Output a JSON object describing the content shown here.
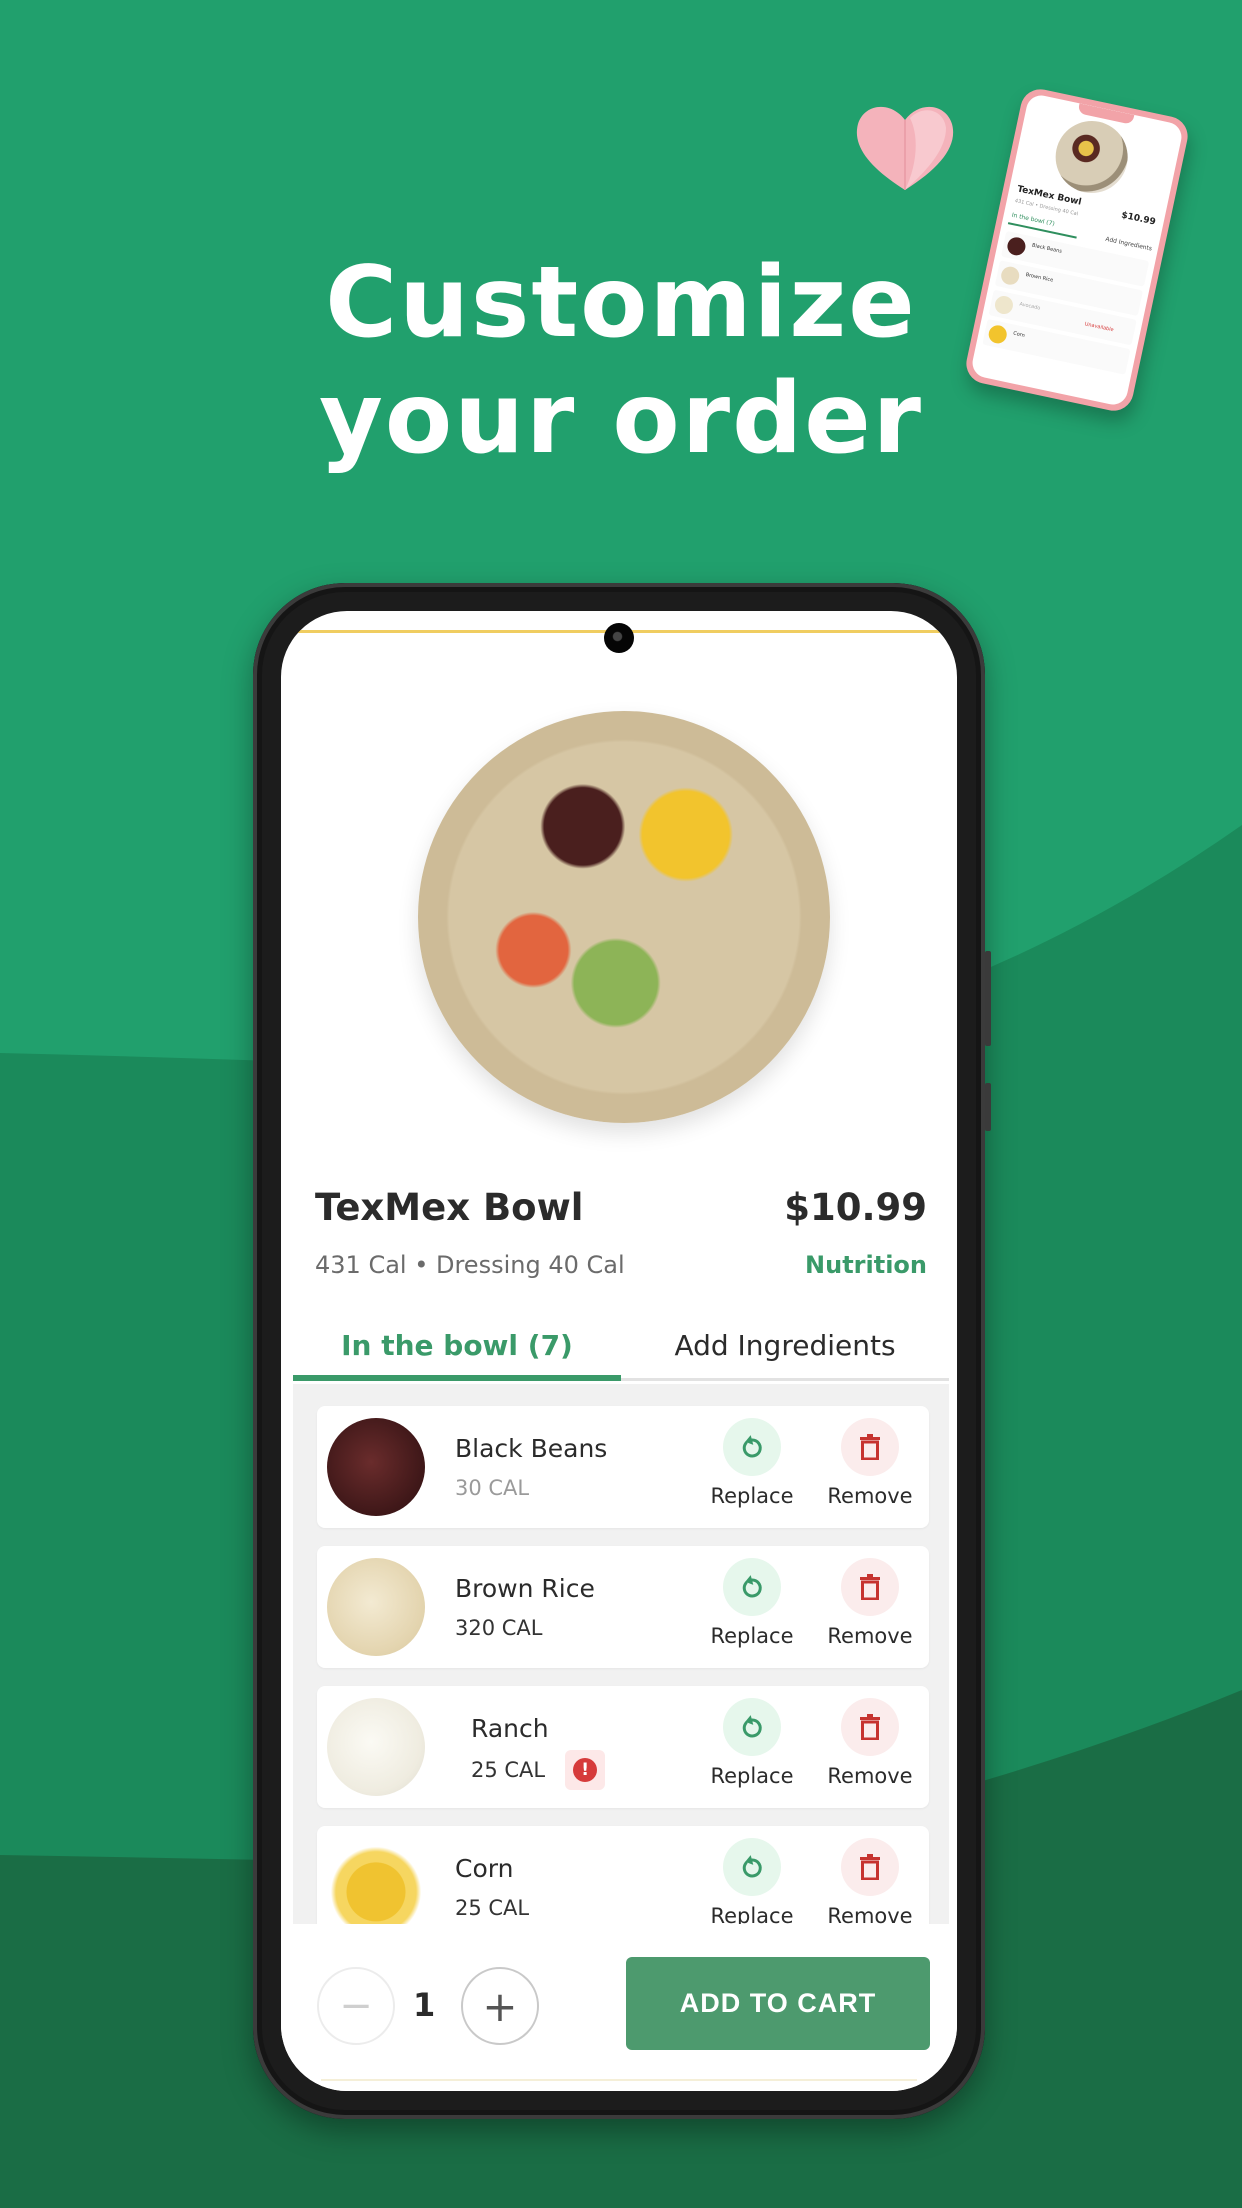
{
  "headline": {
    "line1": "Customize",
    "line2": "your order"
  },
  "colors": {
    "background_top": "#21a06d",
    "background_mid": "#1b8a5b",
    "background_bottom": "#1a6d45",
    "accent": "#3a9a69",
    "button": "#4d9a6e",
    "danger": "#d63b3b"
  },
  "mini_preview": {
    "title": "TexMex Bowl",
    "price": "$10.99",
    "subtitle": "431 Cal • Dressing 40 Cal",
    "tab_active": "In the bowl (7)",
    "tab_other": "Add Ingredients",
    "rows": [
      {
        "name": "Black Beans"
      },
      {
        "name": "Brown Rice"
      },
      {
        "name": "Avocado",
        "status": "Unavailable"
      },
      {
        "name": "Corn"
      }
    ]
  },
  "product": {
    "title": "TexMex Bowl",
    "price": "$10.99",
    "calories": "431 Cal • Dressing 40 Cal",
    "nutrition_link": "Nutrition"
  },
  "tabs": [
    {
      "label": "In the bowl (7)",
      "active": true
    },
    {
      "label": "Add Ingredients",
      "active": false
    }
  ],
  "ingredients": [
    {
      "name": "Black Beans",
      "calories": "30 CAL",
      "warning": false,
      "replace_label": "Replace",
      "remove_label": "Remove"
    },
    {
      "name": "Brown Rice",
      "calories": "320 CAL",
      "warning": false,
      "replace_label": "Replace",
      "remove_label": "Remove"
    },
    {
      "name": "Ranch",
      "calories": "25 CAL",
      "warning": true,
      "warning_icon": "!",
      "replace_label": "Replace",
      "remove_label": "Remove"
    },
    {
      "name": "Corn",
      "calories": "25 CAL",
      "warning": false,
      "replace_label": "Replace",
      "remove_label": "Remove"
    }
  ],
  "cart": {
    "quantity": "1",
    "minus_icon": "−",
    "plus_icon": "+",
    "add_to_cart_label": "ADD TO CART"
  }
}
